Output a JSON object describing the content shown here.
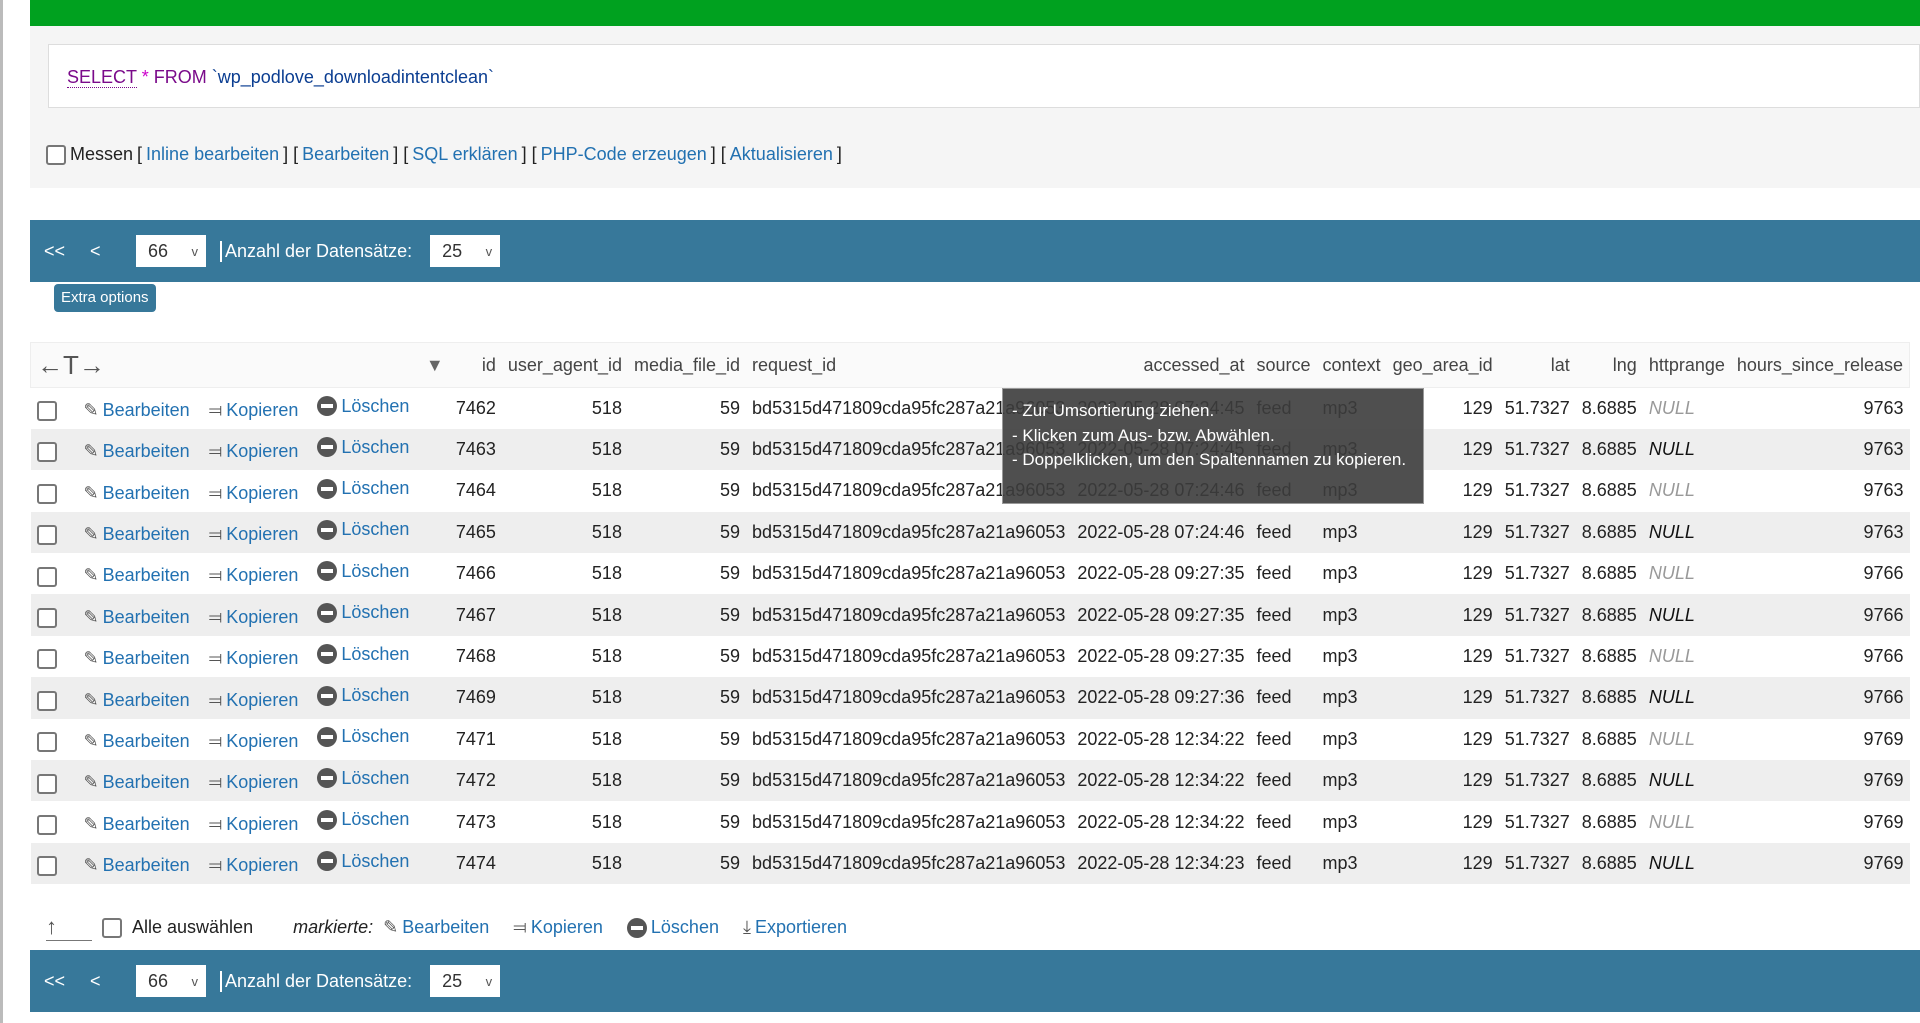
{
  "sql": {
    "select": "SELECT",
    "star": "*",
    "from": "FROM",
    "table": "`wp_podlove_downloadintentclean`"
  },
  "options": {
    "measure": "Messen",
    "links": [
      "Inline bearbeiten",
      "Bearbeiten",
      "SQL erklären",
      "PHP-Code erzeugen",
      "Aktualisieren"
    ]
  },
  "nav": {
    "first": "<<",
    "prev": "<",
    "page": "66",
    "rows_label": "Anzahl der Datensätze:",
    "rows": "25"
  },
  "extra_options": "Extra options",
  "header": {
    "arrows": "←T→",
    "columns": [
      "id",
      "user_agent_id",
      "media_file_id",
      "request_id",
      "accessed_at",
      "source",
      "context",
      "geo_area_id",
      "lat",
      "lng",
      "httprange",
      "hours_since_release"
    ]
  },
  "actions": {
    "edit": "Bearbeiten",
    "copy": "Kopieren",
    "delete": "Löschen"
  },
  "rows": [
    [
      "7462",
      "518",
      "59",
      "bd5315d471809cda95fc287a21a96053",
      "2022-05-28 07:24:45",
      "feed",
      "mp3",
      "129",
      "51.7327",
      "8.6885",
      "NULL",
      "9763"
    ],
    [
      "7463",
      "518",
      "59",
      "bd5315d471809cda95fc287a21a96053",
      "2022-05-28 07:24:45",
      "feed",
      "mp3",
      "129",
      "51.7327",
      "8.6885",
      "NULL",
      "9763"
    ],
    [
      "7464",
      "518",
      "59",
      "bd5315d471809cda95fc287a21a96053",
      "2022-05-28 07:24:46",
      "feed",
      "mp3",
      "129",
      "51.7327",
      "8.6885",
      "NULL",
      "9763"
    ],
    [
      "7465",
      "518",
      "59",
      "bd5315d471809cda95fc287a21a96053",
      "2022-05-28 07:24:46",
      "feed",
      "mp3",
      "129",
      "51.7327",
      "8.6885",
      "NULL",
      "9763"
    ],
    [
      "7466",
      "518",
      "59",
      "bd5315d471809cda95fc287a21a96053",
      "2022-05-28 09:27:35",
      "feed",
      "mp3",
      "129",
      "51.7327",
      "8.6885",
      "NULL",
      "9766"
    ],
    [
      "7467",
      "518",
      "59",
      "bd5315d471809cda95fc287a21a96053",
      "2022-05-28 09:27:35",
      "feed",
      "mp3",
      "129",
      "51.7327",
      "8.6885",
      "NULL",
      "9766"
    ],
    [
      "7468",
      "518",
      "59",
      "bd5315d471809cda95fc287a21a96053",
      "2022-05-28 09:27:35",
      "feed",
      "mp3",
      "129",
      "51.7327",
      "8.6885",
      "NULL",
      "9766"
    ],
    [
      "7469",
      "518",
      "59",
      "bd5315d471809cda95fc287a21a96053",
      "2022-05-28 09:27:36",
      "feed",
      "mp3",
      "129",
      "51.7327",
      "8.6885",
      "NULL",
      "9766"
    ],
    [
      "7471",
      "518",
      "59",
      "bd5315d471809cda95fc287a21a96053",
      "2022-05-28 12:34:22",
      "feed",
      "mp3",
      "129",
      "51.7327",
      "8.6885",
      "NULL",
      "9769"
    ],
    [
      "7472",
      "518",
      "59",
      "bd5315d471809cda95fc287a21a96053",
      "2022-05-28 12:34:22",
      "feed",
      "mp3",
      "129",
      "51.7327",
      "8.6885",
      "NULL",
      "9769"
    ],
    [
      "7473",
      "518",
      "59",
      "bd5315d471809cda95fc287a21a96053",
      "2022-05-28 12:34:22",
      "feed",
      "mp3",
      "129",
      "51.7327",
      "8.6885",
      "NULL",
      "9769"
    ],
    [
      "7474",
      "518",
      "59",
      "bd5315d471809cda95fc287a21a96053",
      "2022-05-28 12:34:23",
      "feed",
      "mp3",
      "129",
      "51.7327",
      "8.6885",
      "NULL",
      "9769"
    ]
  ],
  "tooltip": [
    "- Zur Umsortierung ziehen.",
    "- Klicken zum Aus- bzw. Abwählen.",
    "- Doppelklicken, um den Spaltennamen zu kopieren."
  ],
  "bottom": {
    "select_all": "Alle auswählen",
    "marked": "markierte:",
    "edit": "Bearbeiten",
    "copy": "Kopieren",
    "delete": "Löschen",
    "export": "Exportieren"
  },
  "colors": {
    "green_bar": "#00a11f",
    "nav_bar": "#37789a",
    "link": "#2271b1"
  }
}
